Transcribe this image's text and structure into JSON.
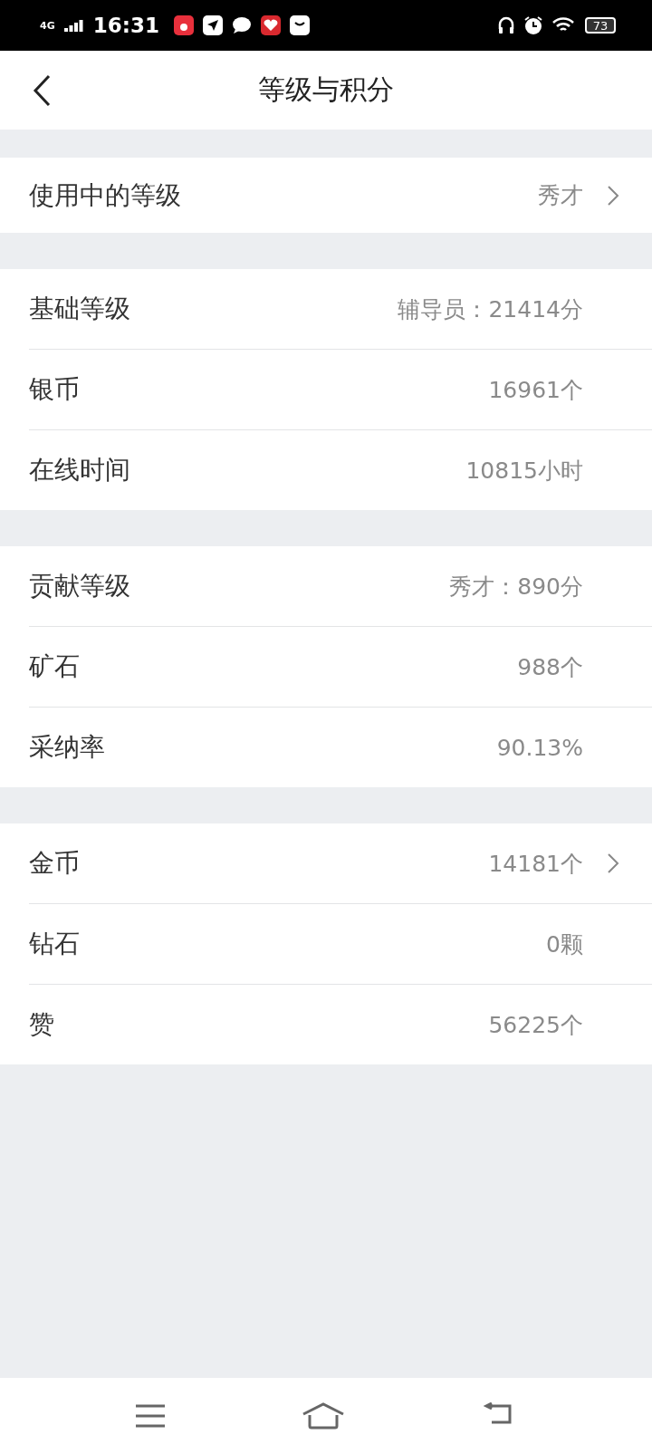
{
  "status_bar": {
    "network": "4G",
    "time": "16:31",
    "battery": "73"
  },
  "header": {
    "title": "等级与积分"
  },
  "sections": [
    {
      "rows": [
        {
          "label": "使用中的等级",
          "value": "秀才",
          "arrow": true
        }
      ]
    },
    {
      "rows": [
        {
          "label": "基础等级",
          "value": "辅导员：21414分",
          "arrow": false
        },
        {
          "label": "银币",
          "value": "16961个",
          "arrow": false
        },
        {
          "label": "在线时间",
          "value": "10815小时",
          "arrow": false
        }
      ]
    },
    {
      "rows": [
        {
          "label": "贡献等级",
          "value": "秀才：890分",
          "arrow": false
        },
        {
          "label": "矿石",
          "value": "988个",
          "arrow": false
        },
        {
          "label": "采纳率",
          "value": "90.13%",
          "arrow": false
        }
      ]
    },
    {
      "rows": [
        {
          "label": "金币",
          "value": "14181个",
          "arrow": true
        },
        {
          "label": "钻石",
          "value": "0颗",
          "arrow": false
        },
        {
          "label": "赞",
          "value": "56225个",
          "arrow": false
        }
      ]
    }
  ]
}
